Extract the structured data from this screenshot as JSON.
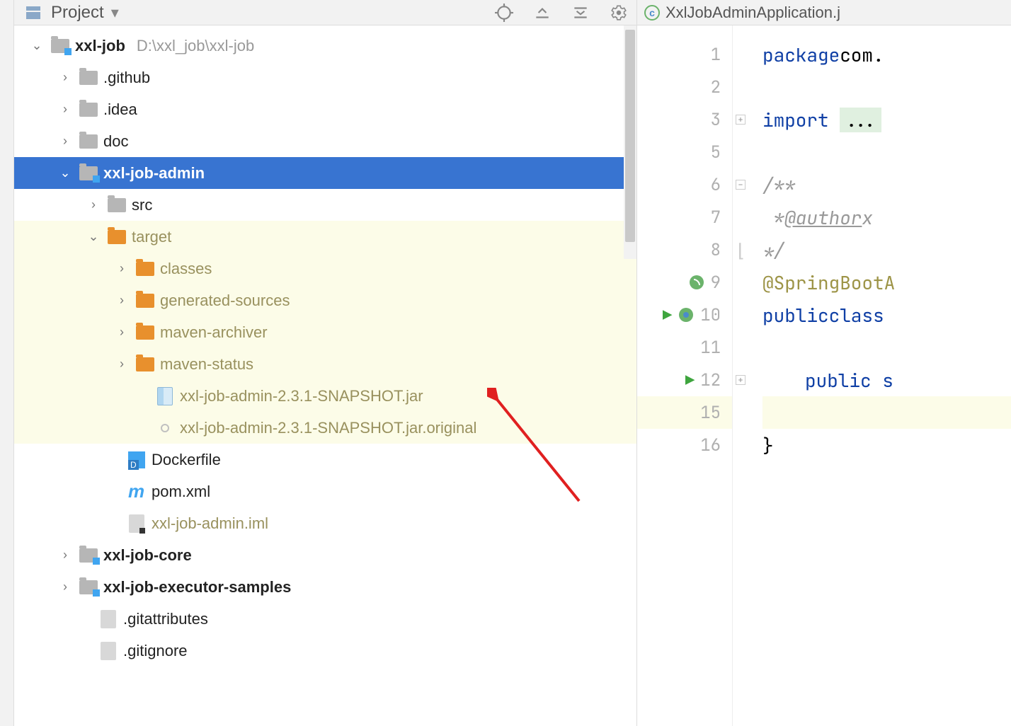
{
  "panel": {
    "title": "Project"
  },
  "tree": {
    "root": {
      "name": "xxl-job",
      "path": "D:\\xxl_job\\xxl-job"
    },
    "github": ".github",
    "idea": ".idea",
    "doc": "doc",
    "admin": "xxl-job-admin",
    "src": "src",
    "target": "target",
    "classes": "classes",
    "gensources": "generated-sources",
    "mavenarch": "maven-archiver",
    "mavenstatus": "maven-status",
    "jar": "xxl-job-admin-2.3.1-SNAPSHOT.jar",
    "jarorig": "xxl-job-admin-2.3.1-SNAPSHOT.jar.original",
    "dockerfile": "Dockerfile",
    "pom": "pom.xml",
    "iml": "xxl-job-admin.iml",
    "core": "xxl-job-core",
    "samples": "xxl-job-executor-samples",
    "gitattr": ".gitattributes",
    "gitignore": ".gitignore"
  },
  "editor": {
    "tab": "XxlJobAdminApplication.j",
    "gutter": [
      "1",
      "2",
      "3",
      "5",
      "6",
      "7",
      "8",
      "9",
      "10",
      "11",
      "12",
      "15",
      "16"
    ],
    "code": {
      "package_kw": "package",
      "package_val": " com.",
      "import_kw": "import",
      "dots": "...",
      "doc_open": "/**",
      "doc_author": " * @author x",
      "doc_close": " */",
      "anno": "@SpringBootA",
      "public_kw": "public",
      "class_kw": " class",
      "public_s": "public s",
      "brace": "}"
    }
  }
}
